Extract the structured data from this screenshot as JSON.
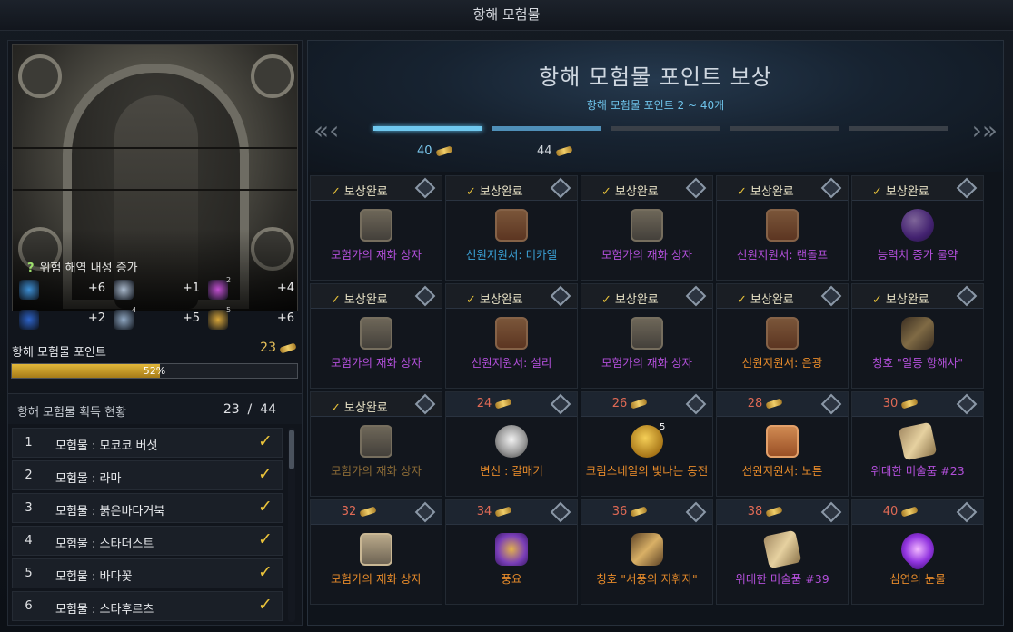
{
  "window": {
    "title": "항해 모험물"
  },
  "relic": {
    "caption": "위험 해역 내성 증가",
    "stats": [
      {
        "icon": "wave-icon",
        "value": "+6",
        "color": "#3d8fd4"
      },
      {
        "icon": "wind-icon",
        "value": "+1",
        "color": "#a9b9cc"
      },
      {
        "icon": "tentacle-icon",
        "value": "+4",
        "color": "#c24fd0"
      },
      {
        "icon": "whirlpool-icon",
        "value": "+2",
        "color": "#2d63c9"
      },
      {
        "icon": "storm-icon",
        "value": "+5",
        "color": "#8fa7c2"
      },
      {
        "icon": "tornado-icon",
        "value": "+6",
        "color": "#d8a63a"
      }
    ],
    "stat_badges": [
      "2",
      "4",
      "5"
    ]
  },
  "points": {
    "label": "항해 모험물 포인트",
    "value": "23",
    "progress_percent": 52,
    "progress_label": "52%"
  },
  "status": {
    "title": "항해 모험물 획득 현황",
    "collected": "23",
    "separator": "/",
    "total": "44"
  },
  "collection": [
    {
      "no": "1",
      "name": "모험물 : 모코코 버섯",
      "checked": true
    },
    {
      "no": "2",
      "name": "모험물 : 라마",
      "checked": true
    },
    {
      "no": "3",
      "name": "모험물 : 붉은바다거북",
      "checked": true
    },
    {
      "no": "4",
      "name": "모험물 : 스타더스트",
      "checked": true
    },
    {
      "no": "5",
      "name": "모험물 : 바다꽃",
      "checked": true
    },
    {
      "no": "6",
      "name": "모험물 : 스타후르츠",
      "checked": true
    }
  ],
  "rewards_panel": {
    "title": "항해 모험물 포인트 보상",
    "subtitle": "항해 모험물 포인트 2 ~ 40개",
    "progress_markers": [
      "40",
      "44"
    ],
    "done_label": "보상완료"
  },
  "rewards": [
    {
      "cost": "",
      "done": true,
      "name": "모험가의 재화 상자",
      "icon": "box",
      "rarity": "purple"
    },
    {
      "cost": "",
      "done": true,
      "name": "선원지원서: 미카엘",
      "icon": "letter",
      "rarity": "blue"
    },
    {
      "cost": "",
      "done": true,
      "name": "모험가의 재화 상자",
      "icon": "box",
      "rarity": "purple"
    },
    {
      "cost": "",
      "done": true,
      "name": "선원지원서: 랜돌프",
      "icon": "letter",
      "rarity": "purple"
    },
    {
      "cost": "",
      "done": true,
      "name": "능력치 증가 물약",
      "icon": "potion",
      "rarity": "purple"
    },
    {
      "cost": "",
      "done": true,
      "name": "모험가의 재화 상자",
      "icon": "box",
      "rarity": "purple"
    },
    {
      "cost": "",
      "done": true,
      "name": "선원지원서: 설리",
      "icon": "letter",
      "rarity": "purple"
    },
    {
      "cost": "",
      "done": true,
      "name": "모험가의 재화 상자",
      "icon": "box",
      "rarity": "purple"
    },
    {
      "cost": "",
      "done": true,
      "name": "선원지원서: 은광",
      "icon": "letter",
      "rarity": "orange"
    },
    {
      "cost": "",
      "done": true,
      "name": "칭호 \"일등 항해사\"",
      "icon": "scroll",
      "rarity": "purple"
    },
    {
      "cost": "",
      "done": true,
      "name": "모험가의 재화 상자",
      "icon": "box",
      "rarity": "dim"
    },
    {
      "cost": "24",
      "done": false,
      "name": "변신 : 갈매기",
      "icon": "bird",
      "rarity": "orange"
    },
    {
      "cost": "26",
      "done": false,
      "name": "크림스네일의 빛나는 동전",
      "icon": "coin",
      "rarity": "orange",
      "badge": "5"
    },
    {
      "cost": "28",
      "done": false,
      "name": "선원지원서: 노튼",
      "icon": "letter",
      "rarity": "orange"
    },
    {
      "cost": "30",
      "done": false,
      "name": "위대한 미술품 #23",
      "icon": "art",
      "rarity": "purple"
    },
    {
      "cost": "32",
      "done": false,
      "name": "모험가의 재화 상자",
      "icon": "box",
      "rarity": "orange"
    },
    {
      "cost": "34",
      "done": false,
      "name": "풍요",
      "icon": "wealth",
      "rarity": "orange"
    },
    {
      "cost": "36",
      "done": false,
      "name": "칭호 \"서풍의 지휘자\"",
      "icon": "scroll",
      "rarity": "orange"
    },
    {
      "cost": "38",
      "done": false,
      "name": "위대한 미술품 #39",
      "icon": "art",
      "rarity": "purple"
    },
    {
      "cost": "40",
      "done": false,
      "name": "심연의 눈물",
      "icon": "tear",
      "rarity": "orange"
    }
  ]
}
